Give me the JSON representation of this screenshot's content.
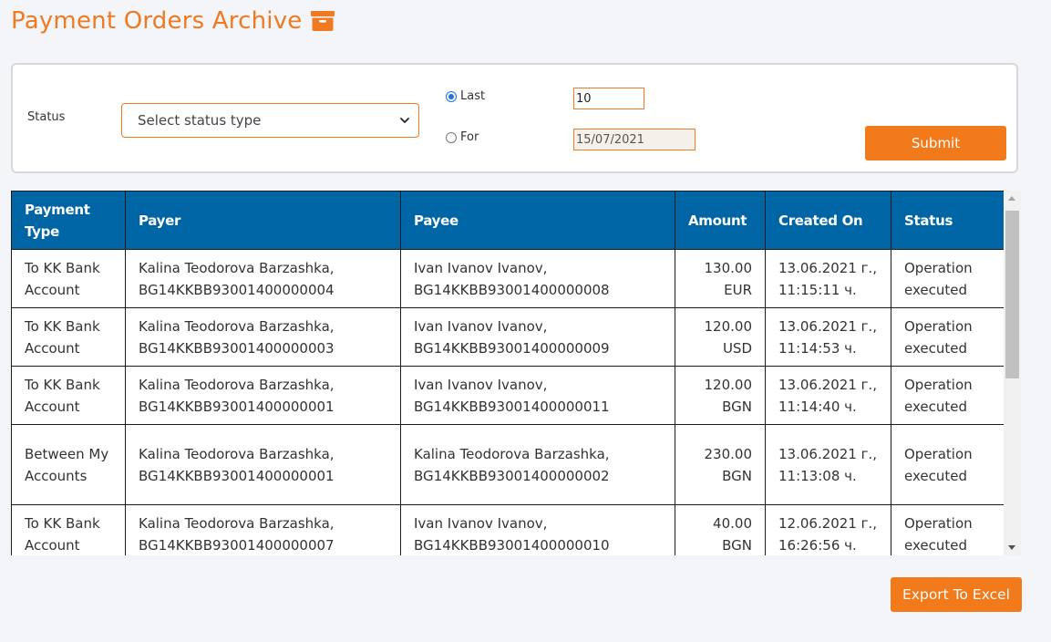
{
  "page": {
    "title": "Payment Orders Archive",
    "title_icon": "archive-box-icon",
    "accent_color": "#f07a22",
    "header_color": "#0065a5"
  },
  "filters": {
    "status_label": "Status",
    "status_select_value": "Select status type",
    "last_label": "Last",
    "last_value": "10",
    "last_selected": true,
    "for_label": "For",
    "for_value": "15/07/2021",
    "for_selected": false,
    "submit_label": "Submit"
  },
  "table": {
    "columns": [
      "Payment Type",
      "Payer",
      "Payee",
      "Amount",
      "Created On",
      "Status"
    ],
    "rows": [
      {
        "payment_type": "To KK Bank Account",
        "payer": "Kalina Teodorova Barzashka, BG14KKBB93001400000004",
        "payee": "Ivan Ivanov Ivanov, BG14KKBB93001400000008",
        "amount": "130.00",
        "currency": "EUR",
        "created_date": "13.06.2021 г.,",
        "created_time": "11:15:11 ч.",
        "status": "Operation executed"
      },
      {
        "payment_type": "To KK Bank Account",
        "payer": "Kalina Teodorova Barzashka, BG14KKBB93001400000003",
        "payee": "Ivan Ivanov Ivanov, BG14KKBB93001400000009",
        "amount": "120.00",
        "currency": "USD",
        "created_date": "13.06.2021 г.,",
        "created_time": "11:14:53 ч.",
        "status": "Operation executed"
      },
      {
        "payment_type": "To KK Bank Account",
        "payer": "Kalina Teodorova Barzashka, BG14KKBB93001400000001",
        "payee": "Ivan Ivanov Ivanov, BG14KKBB93001400000011",
        "amount": "120.00",
        "currency": "BGN",
        "created_date": "13.06.2021 г.,",
        "created_time": "11:14:40 ч.",
        "status": "Operation executed"
      },
      {
        "payment_type": "Between My Accounts",
        "payer": "Kalina Teodorova Barzashka, BG14KKBB93001400000001",
        "payee": "Kalina Teodorova Barzashka, BG14KKBB93001400000002",
        "amount": "230.00",
        "currency": "BGN",
        "created_date": "13.06.2021 г.,",
        "created_time": "11:13:08 ч.",
        "status": "Operation executed"
      },
      {
        "payment_type": "To KK Bank Account",
        "payer": "Kalina Teodorova Barzashka, BG14KKBB93001400000007",
        "payee": "Ivan Ivanov Ivanov, BG14KKBB93001400000010",
        "amount": "40.00",
        "currency": "BGN",
        "created_date": "12.06.2021 г.,",
        "created_time": "16:26:56 ч.",
        "status": "Operation executed"
      }
    ]
  },
  "export": {
    "label": "Export To Excel"
  }
}
